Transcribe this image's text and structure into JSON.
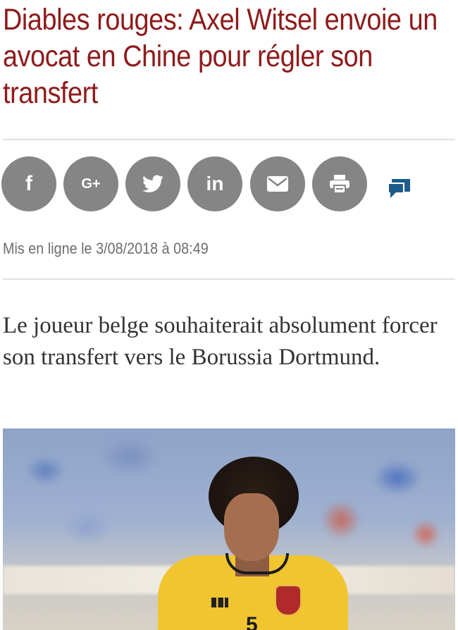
{
  "article": {
    "headline": "Diables rouges: Axel Witsel envoie un avocat en Chine pour régler son transfert",
    "published": "Mis en ligne le 3/08/2018 à 08:49",
    "lead": "Le joueur belge souhaiterait absolument forcer son transfert vers le Borussia Dortmund."
  },
  "share": {
    "buttons": [
      {
        "name": "facebook",
        "icon": "facebook-icon",
        "label": "f"
      },
      {
        "name": "google-plus",
        "icon": "google-plus-icon",
        "label": "G+"
      },
      {
        "name": "twitter",
        "icon": "twitter-icon"
      },
      {
        "name": "linkedin",
        "icon": "linkedin-icon",
        "label": "in"
      },
      {
        "name": "email",
        "icon": "mail-icon"
      },
      {
        "name": "print",
        "icon": "print-icon"
      }
    ],
    "comments_icon": "comments-icon",
    "button_color": "#858585",
    "comments_color": "#1d5c8a"
  },
  "photo": {
    "shirt_number": "5"
  },
  "colors": {
    "headline": "#8e1b1b",
    "meta": "#6d6d6d",
    "lead": "#333333"
  }
}
